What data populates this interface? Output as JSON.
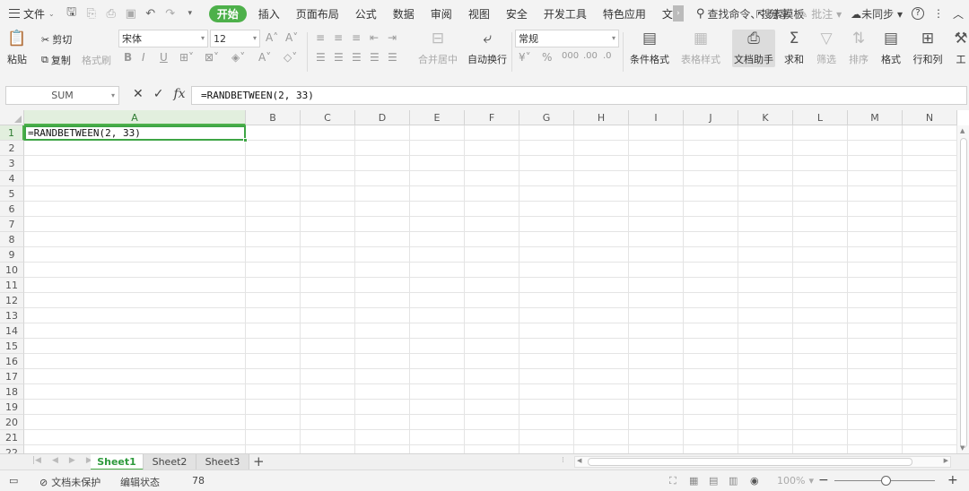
{
  "topbar": {
    "menu_label": "文件",
    "tabs": [
      "开始",
      "插入",
      "页面布局",
      "公式",
      "数据",
      "审阅",
      "视图",
      "安全",
      "开发工具",
      "特色应用",
      "文"
    ],
    "active_tab": "开始",
    "search_label": "查找命令、搜索模板",
    "share_label": "分享",
    "comment_label": "批注",
    "sync_label": "未同步"
  },
  "ribbon": {
    "paste": "粘贴",
    "cut": "剪切",
    "copy": "复制",
    "format_painter": "格式刷",
    "font_name": "宋体",
    "font_size": "12",
    "merge_center": "合并居中",
    "wrap_text": "自动换行",
    "number_format": "常规",
    "conditional_format": "条件格式",
    "table_style": "表格样式",
    "doc_assistant": "文档助手",
    "sum": "求和",
    "filter": "筛选",
    "sort": "排序",
    "format": "格式",
    "rows_cols": "行和列",
    "tools_partial": "工"
  },
  "formula_bar": {
    "name_box": "SUM",
    "fx": "fx",
    "formula": "=RANDBETWEEN(2, 33)"
  },
  "grid": {
    "columns": [
      "A",
      "B",
      "C",
      "D",
      "E",
      "F",
      "G",
      "H",
      "I",
      "J",
      "K",
      "L",
      "M",
      "N"
    ],
    "rows": [
      "1",
      "2",
      "3",
      "4",
      "5",
      "6",
      "7",
      "8",
      "9",
      "10",
      "11",
      "12",
      "13",
      "14",
      "15",
      "16",
      "17",
      "18",
      "19",
      "20",
      "21",
      "22"
    ],
    "active_cell_value": "=RANDBETWEEN(2, 33)"
  },
  "sheets": [
    "Sheet1",
    "Sheet2",
    "Sheet3"
  ],
  "active_sheet": "Sheet1",
  "status": {
    "protection": "文档未保护",
    "mode": "编辑状态",
    "value": "78",
    "zoom": "100%"
  },
  "colors": {
    "accent": "#4db04a",
    "selection_border": "#3ea545"
  }
}
